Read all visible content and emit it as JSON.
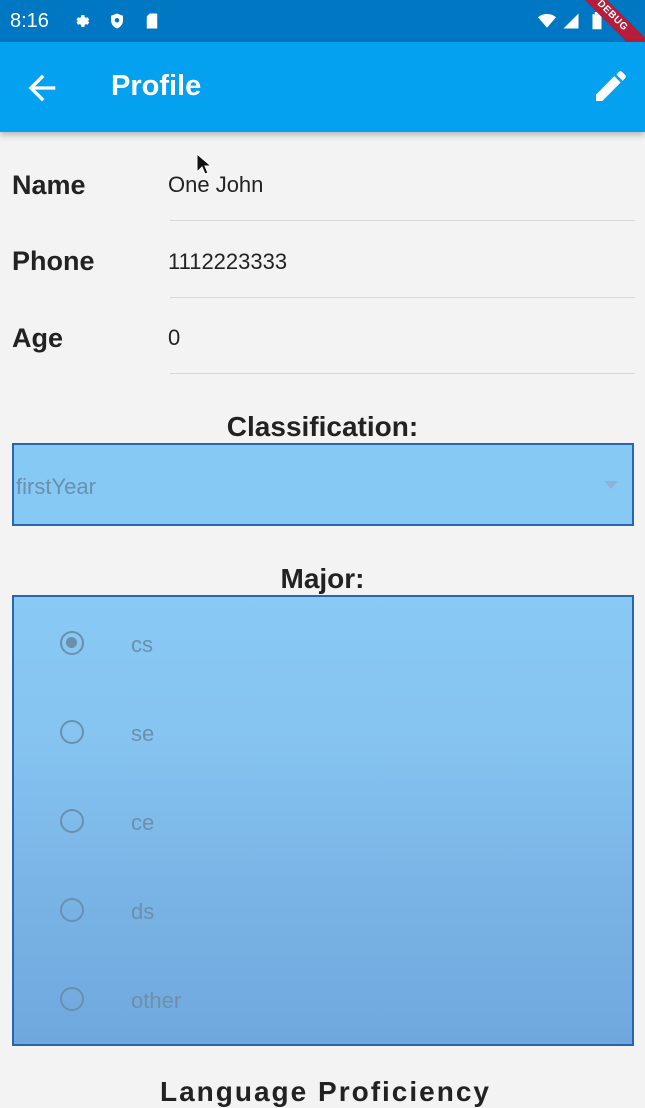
{
  "status_bar": {
    "time": "8:16",
    "debug_label": "DEBUG"
  },
  "app_bar": {
    "title": "Profile"
  },
  "fields": [
    {
      "label": "Name",
      "value": "One John"
    },
    {
      "label": "Phone",
      "value": "1112223333"
    },
    {
      "label": "Age",
      "value": "0"
    }
  ],
  "classification": {
    "title": "Classification:",
    "selected": "firstYear"
  },
  "major": {
    "title": "Major:",
    "options": [
      {
        "label": "cs",
        "selected": true
      },
      {
        "label": "se",
        "selected": false
      },
      {
        "label": "ce",
        "selected": false
      },
      {
        "label": "ds",
        "selected": false
      },
      {
        "label": "other",
        "selected": false
      }
    ]
  },
  "next_section_partial": "Language Proficiency"
}
